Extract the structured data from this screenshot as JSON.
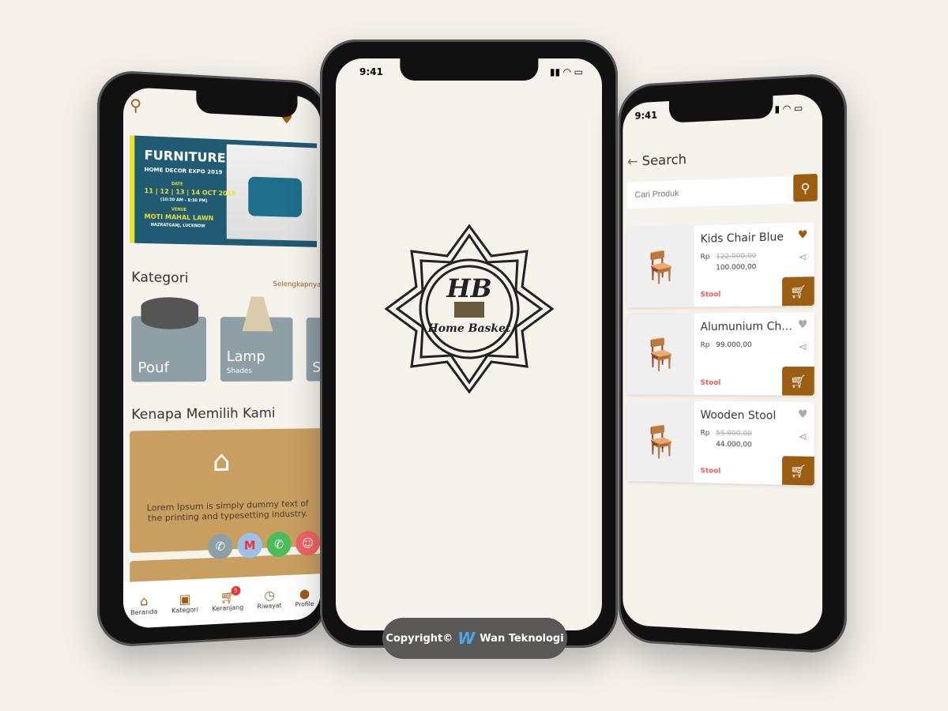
{
  "left": {
    "banner": {
      "title": "FURNITURE",
      "subtitle": "HOME DECOR EXPO 2019",
      "date_label": "DATE",
      "dates": "11 | 12 | 13 | 14 OCT 2019",
      "time": "(10:30 AM - 8:30 PM)",
      "venue_label": "VENUE",
      "venue": "MOTI MAHAL LAWN",
      "location": "HAZRATGANJ, LUCKNOW"
    },
    "kategori_title": "Kategori",
    "see_more": "Selengkapnya",
    "categories": [
      {
        "name": "Pouf",
        "sub": ""
      },
      {
        "name": "Lamp",
        "sub": "Shades"
      },
      {
        "name": "S",
        "sub": ""
      }
    ],
    "why_title": "Kenapa Memilih Kami",
    "why_text": "Lorem Ipsum is simply dummy text of the printing and typesetting industry.",
    "nav": [
      {
        "label": "Beranda",
        "icon": "home-icon"
      },
      {
        "label": "Kategori",
        "icon": "bag-icon"
      },
      {
        "label": "Keranjang",
        "icon": "cart-icon",
        "badge": "5"
      },
      {
        "label": "Riwayat",
        "icon": "history-icon"
      },
      {
        "label": "Profile",
        "icon": "user-icon"
      }
    ]
  },
  "center": {
    "time": "9:41",
    "logo_text": "HB",
    "logo_sub": "Home Basket"
  },
  "right": {
    "time": "9:41",
    "title": "Search",
    "search_placeholder": "Cari Produk",
    "products": [
      {
        "name": "Kids Chair Blue",
        "currency": "Rp",
        "old_price": "122.000,00",
        "price": "100.000,00",
        "category": "Stool",
        "favorite": true
      },
      {
        "name": "Alumunium Ch...",
        "currency": "Rp",
        "old_price": "",
        "price": "99.000,00",
        "category": "Stool",
        "favorite": false
      },
      {
        "name": "Wooden Stool",
        "currency": "Rp",
        "old_price": "55.000,00",
        "price": "44.000,00",
        "category": "Stool",
        "favorite": false
      }
    ]
  },
  "copyright": {
    "prefix": "Copyright©",
    "brand": "Wan Teknologi"
  },
  "colors": {
    "accent": "#9a5d12",
    "background": "#f4efe9",
    "tag": "#f25757"
  }
}
